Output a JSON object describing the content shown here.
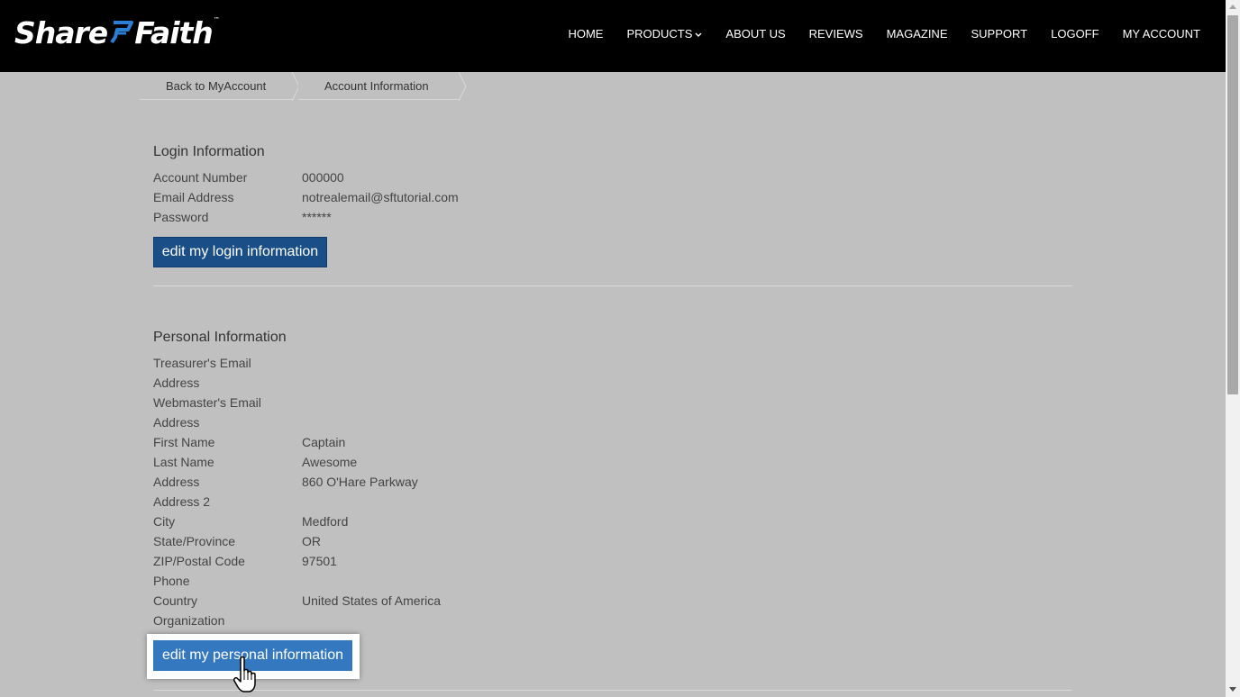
{
  "header": {
    "logo_part1": "Share",
    "logo_part2": "Faith",
    "logo_tm": "™",
    "nav": [
      {
        "label": "HOME"
      },
      {
        "label": "PRODUCTS"
      },
      {
        "label": "ABOUT US"
      },
      {
        "label": "REVIEWS"
      },
      {
        "label": "MAGAZINE"
      },
      {
        "label": "SUPPORT"
      },
      {
        "label": "LOGOFF"
      },
      {
        "label": "MY ACCOUNT"
      }
    ],
    "products_icon": "chevron-down-icon"
  },
  "breadcrumb": {
    "back": "Back to MyAccount",
    "current": "Account Information"
  },
  "login": {
    "title": "Login Information",
    "fields": [
      {
        "label": "Account Number",
        "value": "000000"
      },
      {
        "label": "Email Address",
        "value": "notrealemail@sftutorial.com"
      },
      {
        "label": "Password",
        "value": "******"
      }
    ],
    "edit_button": "edit my login information"
  },
  "personal": {
    "title": "Personal Information",
    "fields": [
      {
        "label": "Treasurer's Email",
        "value": ""
      },
      {
        "label": "Address",
        "value": ""
      },
      {
        "label": "Webmaster's Email",
        "value": ""
      },
      {
        "label": "Address",
        "value": ""
      },
      {
        "label": "First Name",
        "value": "Captain"
      },
      {
        "label": "Last Name",
        "value": "Awesome"
      },
      {
        "label": "Address",
        "value": "860 O'Hare Parkway"
      },
      {
        "label": "Address 2",
        "value": ""
      },
      {
        "label": "City",
        "value": "Medford"
      },
      {
        "label": "State/Province",
        "value": "OR"
      },
      {
        "label": "ZIP/Postal Code",
        "value": "97501"
      },
      {
        "label": "Phone",
        "value": ""
      },
      {
        "label": "Country",
        "value": "United States of America"
      },
      {
        "label": "Organization",
        "value": ""
      }
    ],
    "edit_button": "edit my personal information"
  },
  "colors": {
    "topbar": "#000000",
    "page_bg": "#c0c0c0",
    "login_button": "#1a4e86",
    "personal_button": "#3478c0",
    "logo_accent": "#2a7fd4"
  },
  "cursor_icon": "hand-pointer-icon"
}
